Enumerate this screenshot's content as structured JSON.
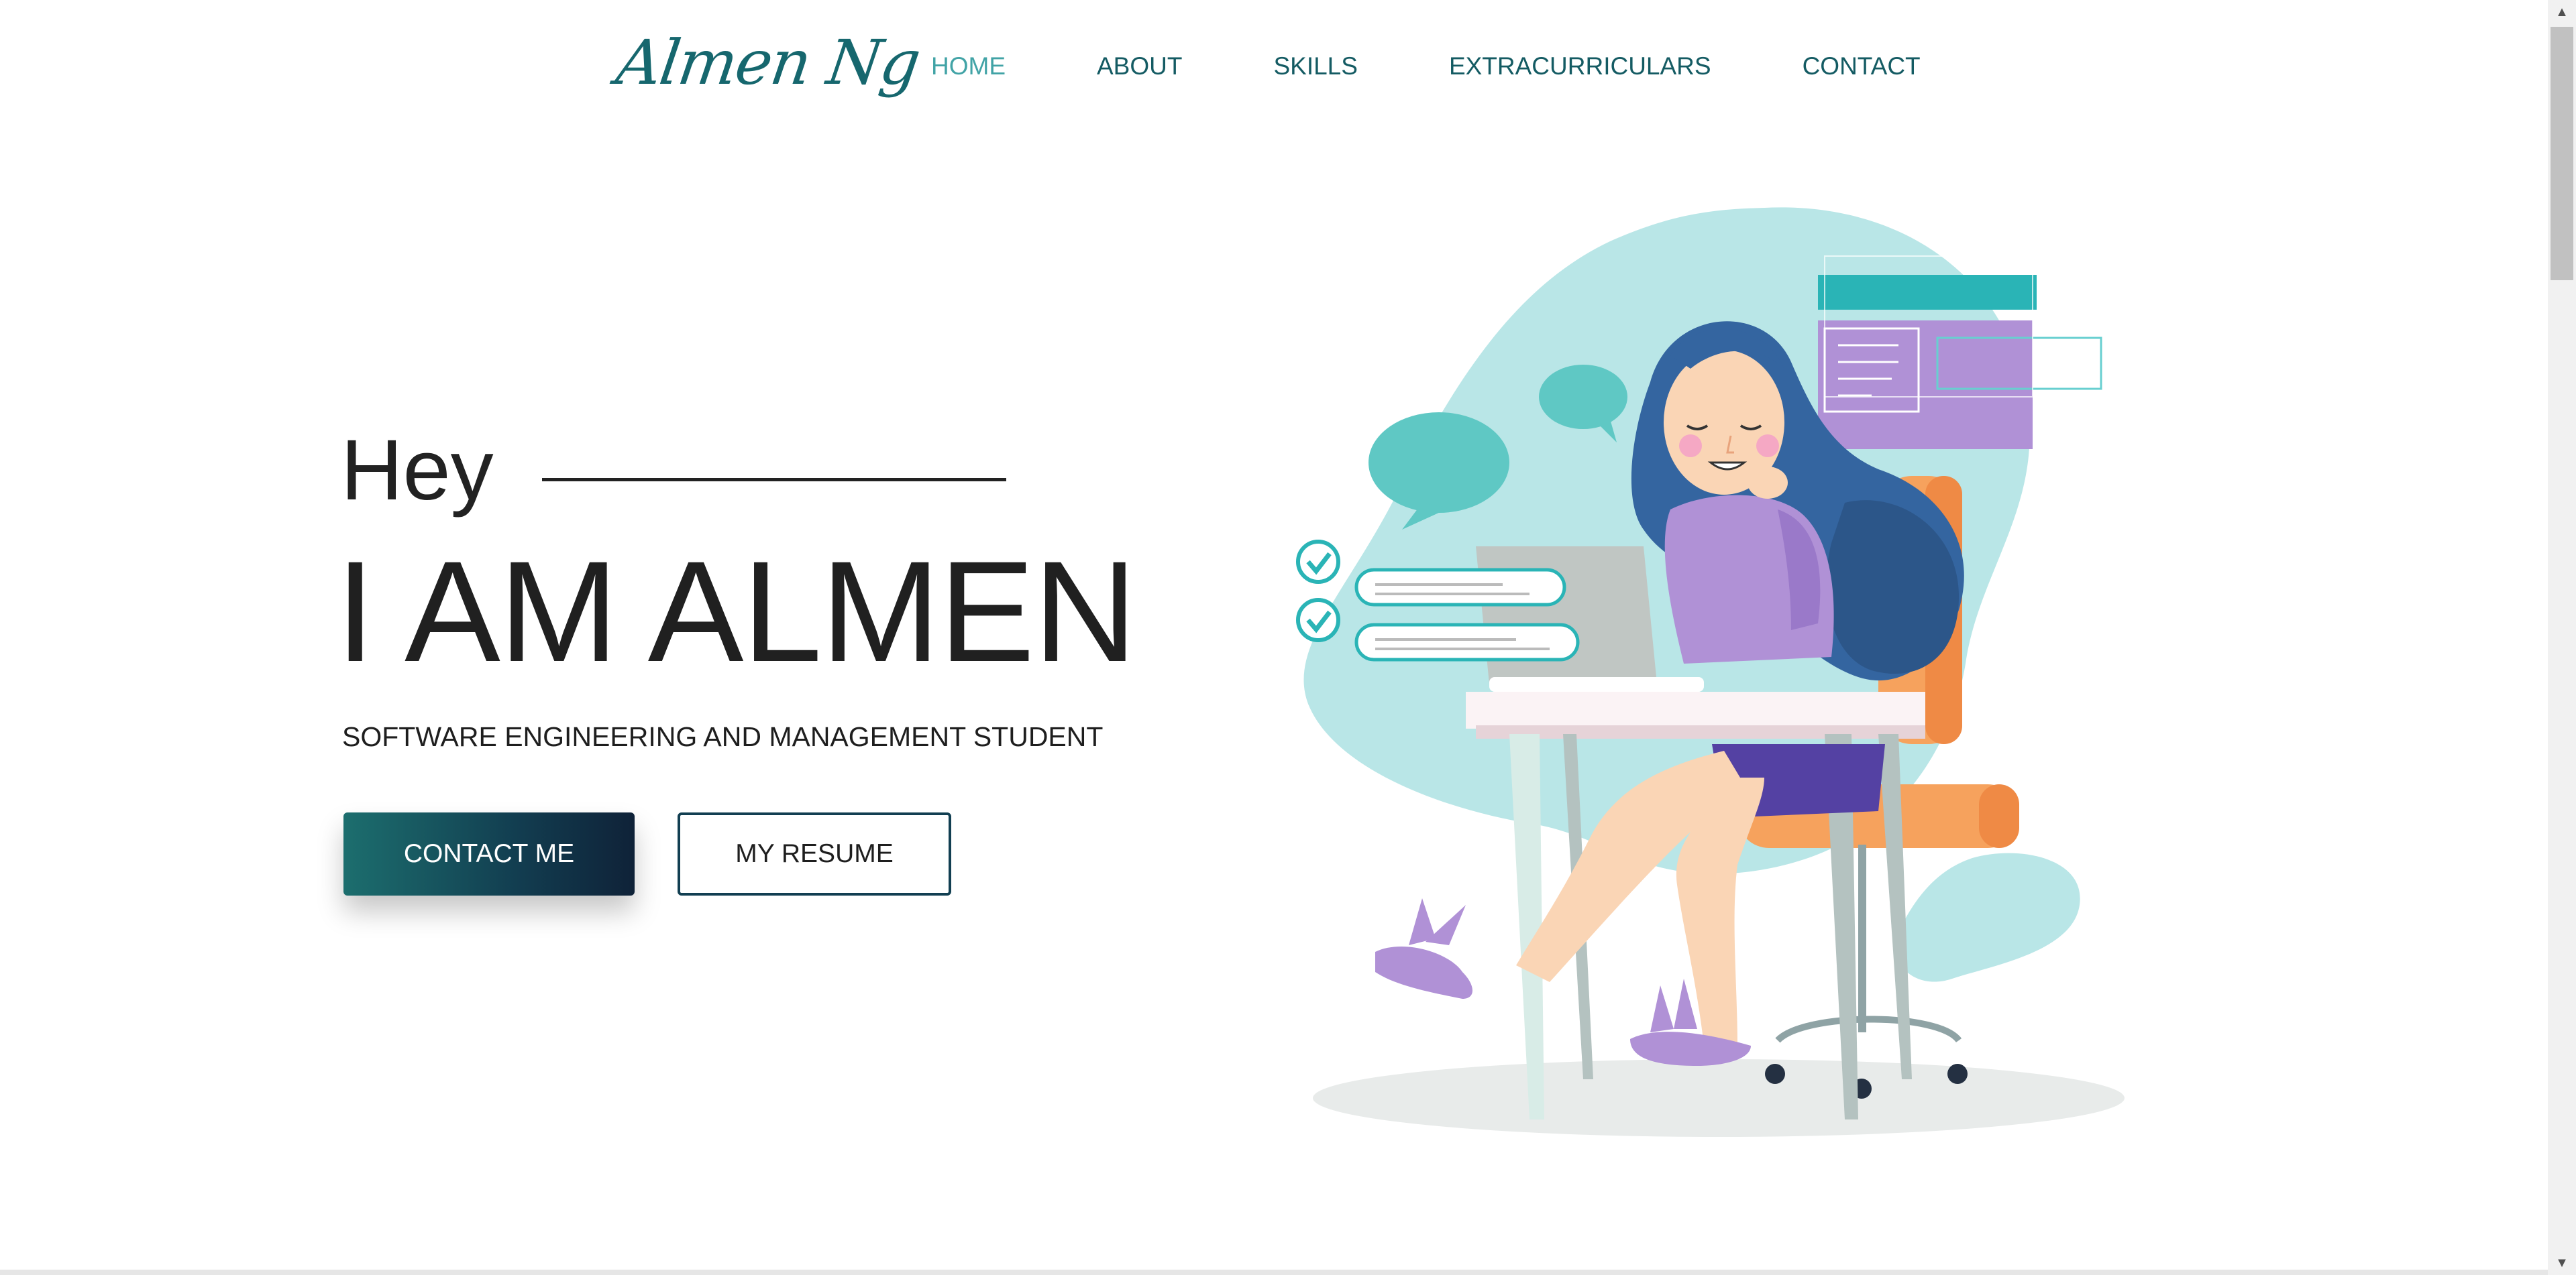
{
  "header": {
    "logo_text": "Almen Ng",
    "nav": [
      {
        "label": "HOME",
        "active": true
      },
      {
        "label": "ABOUT",
        "active": false
      },
      {
        "label": "SKILLS",
        "active": false
      },
      {
        "label": "EXTRACURRICULARS",
        "active": false
      },
      {
        "label": "CONTACT",
        "active": false
      }
    ]
  },
  "hero": {
    "greeting": "Hey",
    "headline": "I AM ALMEN",
    "subtitle": "SOFTWARE ENGINEERING AND MANAGEMENT STUDENT",
    "primary_button": "CONTACT ME",
    "secondary_button": "MY RESUME"
  },
  "colors": {
    "brand_teal": "#16676e",
    "nav_active": "#41a3a6",
    "blob": "#b9e6e7",
    "purple": "#b091d6",
    "orange": "#f6a25d"
  },
  "icons": [
    "scroll-up-arrow-icon",
    "scroll-down-arrow-icon",
    "checkmark-icon"
  ]
}
